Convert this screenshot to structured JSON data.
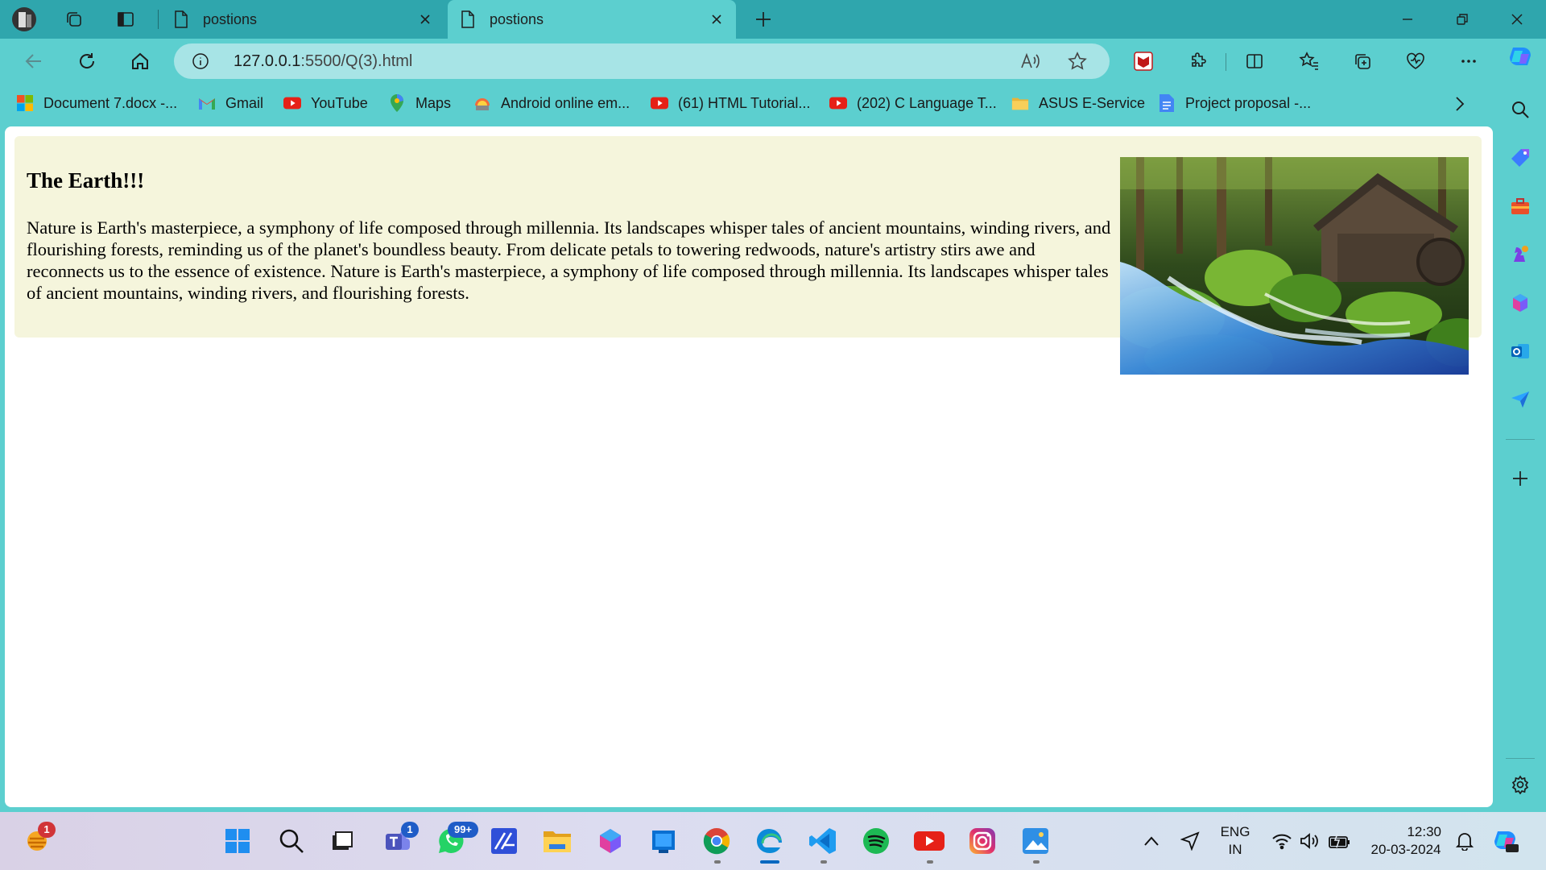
{
  "browser": {
    "tabs": [
      {
        "title": "postions",
        "active": false
      },
      {
        "title": "postions",
        "active": true
      }
    ],
    "address": {
      "host": "127.0.0.1",
      "rest": ":5500/Q(3).html"
    },
    "bookmarks": [
      {
        "label": "Document 7.docx -...",
        "icon": "microsoft-icon"
      },
      {
        "label": "Gmail",
        "icon": "gmail-icon"
      },
      {
        "label": "YouTube",
        "icon": "youtube-icon"
      },
      {
        "label": "Maps",
        "icon": "maps-icon"
      },
      {
        "label": "Android online em...",
        "icon": "android-emulator-icon"
      },
      {
        "label": "(61) HTML Tutorial...",
        "icon": "youtube-icon"
      },
      {
        "label": "(202) C Language T...",
        "icon": "youtube-icon"
      },
      {
        "label": "ASUS E-Service",
        "icon": "folder-icon"
      },
      {
        "label": "Project proposal -...",
        "icon": "google-docs-icon"
      }
    ]
  },
  "page": {
    "heading": "The Earth!!!",
    "paragraph": "Nature is Earth's masterpiece, a symphony of life composed through millennia. Its landscapes whisper tales of ancient mountains, winding rivers, and flourishing forests, reminding us of the planet's boundless beauty. From delicate petals to towering redwoods, nature's artistry stirs awe and reconnects us to the essence of existence. Nature is Earth's masterpiece, a symphony of life composed through millennia. Its landscapes whisper tales of ancient mountains, winding rivers, and flourishing forests.",
    "background_color": "#f5f5dc"
  },
  "taskbar": {
    "weather_badge": "1",
    "teams_badge": "1",
    "whatsapp_badge": "99+",
    "language": "ENG",
    "region": "IN",
    "time": "12:30",
    "date": "20-03-2024"
  },
  "colors": {
    "frame": "#2fa6ad",
    "toolbar": "#5ccfcf",
    "omnibox": "#a7e4e6"
  }
}
